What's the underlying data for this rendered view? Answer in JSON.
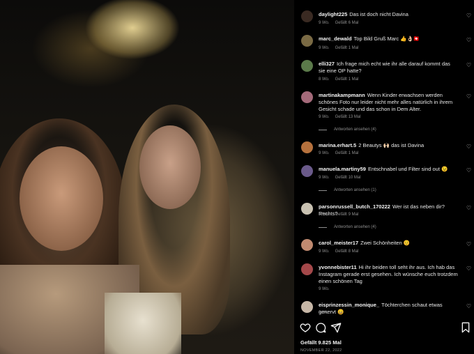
{
  "photo": {
    "alt": ""
  },
  "comments": [
    {
      "user": "daylight225",
      "text": "Das ist doch nicht Davina",
      "time": "9 Wo.",
      "likes": "Gefällt 6 Mal",
      "avatar_color": "#3a2a22",
      "replies": ""
    },
    {
      "user": "marc_dewald",
      "text": "Top Bild Gruß Marc 👍👌🏻🇨🇭",
      "time": "9 Wo.",
      "likes": "Gefällt 1 Mal",
      "avatar_color": "#7a6a44",
      "replies": ""
    },
    {
      "user": "elli327",
      "text": "Ich frage mich echt wie ihr alle darauf kommt das sie eine OP hatte?",
      "time": "8 Wo.",
      "likes": "Gefällt 1 Mal",
      "avatar_color": "#5b7a4a",
      "replies": ""
    },
    {
      "user": "martinakampmann",
      "text": "Wenn Kinder erwachsen werden schönes Foto nur leider nicht mehr alles natürlich in ihrem Gesicht schade und das schon in Dem Alter.",
      "time": "9 Wo.",
      "likes": "Gefällt 13 Mal",
      "avatar_color": "#a46a7a",
      "replies": "Antworten ansehen (4)"
    },
    {
      "user": "marina.erhart.5",
      "text": "2 Beautys 🙌🏻 das ist Davina",
      "time": "9 Wo.",
      "likes": "Gefällt 1 Mal",
      "avatar_color": "#b5713d",
      "replies": ""
    },
    {
      "user": "manuela.martiny59",
      "text": "Entschnabel und Filter sind out 😉",
      "time": "9 Wo.",
      "likes": "Gefällt 10 Mal",
      "avatar_color": "#6a5a8a",
      "replies": "Antworten ansehen (1)"
    },
    {
      "user": "parsonrussell_butch_170222",
      "text": "Wer ist das neben dir?Rechts?",
      "time": "9 Wo.",
      "likes": "Gefällt 9 Mal",
      "avatar_color": "#c9c2b2",
      "replies": "Antworten ansehen (4)"
    },
    {
      "user": "carol_meister17",
      "text": "Zwei Schönheiten 😊",
      "time": "9 Wo.",
      "likes": "Gefällt 8 Mal",
      "avatar_color": "#c08a70",
      "replies": ""
    },
    {
      "user": "yvonnebister11",
      "text": "Hi ihr beiden toll seht ihr aus. Ich hab das Instagram gerade erst gesehen. Ich wünsche euch trotzdem einen schönen Tag",
      "time": "9 Wo.",
      "likes": "",
      "avatar_color": "#a4484a",
      "replies": ""
    },
    {
      "user": "eisprinzessin_monique_",
      "text": "Töchterchen schaut etwas genervt 😄",
      "time": "9 Wo.",
      "likes": "",
      "avatar_color": "#c7b7a7",
      "replies": ""
    }
  ],
  "footer": {
    "likes": "Gefällt 9.825 Mal",
    "date": "NOVEMBER 22, 2022"
  },
  "icons": {
    "like": "heart-icon",
    "comment": "comment-icon",
    "share": "share-icon",
    "save": "bookmark-icon"
  }
}
